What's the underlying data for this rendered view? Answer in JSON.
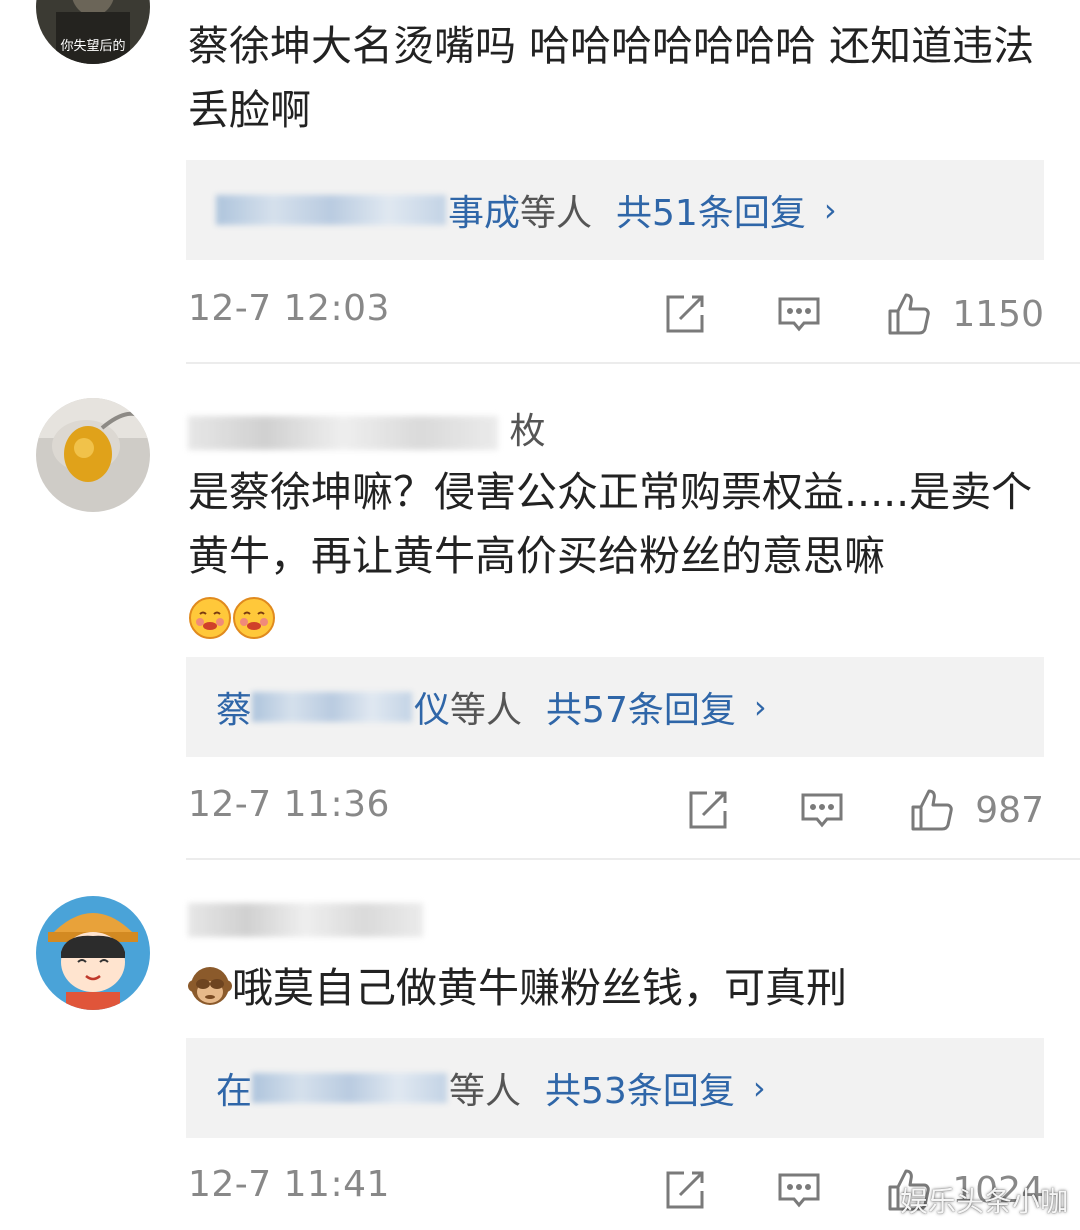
{
  "comments": [
    {
      "username_suffix": "",
      "avatar_caption": "你失望后的",
      "text": "蔡徐坤大名烫嘴吗 哈哈哈哈哈哈哈 还知道违法丢脸啊",
      "emoji_count": 0,
      "reply": {
        "names_tail": "事成",
        "others": "等人",
        "count_label": "共51条回复",
        "chevron": "›"
      },
      "time": "12-7 12:03",
      "likes": "1150"
    },
    {
      "username_suffix": "枚",
      "avatar_caption": "",
      "text": "是蔡徐坤嘛？侵害公众正常购票权益.....是卖个黄牛，再让黄牛高价买给粉丝的意思嘛",
      "emoji_count": 2,
      "reply": {
        "names_head": "蔡",
        "names_tail": "仪",
        "others": "等人",
        "count_label": "共57条回复",
        "chevron": "›"
      },
      "time": "12-7 11:36",
      "likes": "987"
    },
    {
      "username_suffix": "",
      "avatar_caption": "",
      "text": "哦莫自己做黄牛赚粉丝钱，可真刑",
      "emoji_count": 1,
      "reply": {
        "names_head": "在",
        "names_tail": "",
        "others": "等人",
        "count_label": "共53条回复",
        "chevron": "›"
      },
      "time": "12-7 11:41",
      "likes": "1024"
    }
  ],
  "watermark": "娱乐头条小咖",
  "icons": {
    "share": "share-edit-icon",
    "comment": "comment-bubble-icon",
    "like": "thumbs-up-icon"
  },
  "colors": {
    "link_blue": "#2f66a8",
    "reply_bg": "#f2f2f2",
    "meta_gray": "#888888"
  }
}
